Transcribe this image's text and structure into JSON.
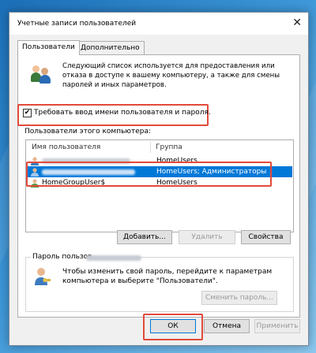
{
  "window": {
    "title": "Учетные записи пользователей",
    "close_glyph": "✕"
  },
  "tabs": [
    {
      "label": "Пользователи"
    },
    {
      "label": "Дополнительно"
    }
  ],
  "intro_text": "Следующий список используется для предоставления или отказа в доступе к вашему компьютеру, а также для смены паролей и иных параметров.",
  "require_login": {
    "label": "Требовать ввод имени пользователя и пароля.",
    "checked_glyph": "✔"
  },
  "users_section_label": "Пользователи этого компьютера:",
  "users_table": {
    "columns": [
      "Имя пользователя",
      "Группа"
    ],
    "rows": [
      {
        "name": "",
        "group": "HomeUsers",
        "selected": false
      },
      {
        "name": "",
        "group": "HomeUsers; Администраторы",
        "selected": true
      },
      {
        "name": "HomeGroupUser$",
        "group": "HomeUsers",
        "selected": false
      }
    ]
  },
  "buttons": {
    "add": "Добавить...",
    "remove": "Удалить",
    "properties": "Свойства"
  },
  "password_group": {
    "legend": "Пароль пользов",
    "text": "Чтобы изменить свой пароль, перейдите к параметрам компьютера и выберите \"Пользователи\".",
    "change_button": "Сменить пароль..."
  },
  "dialog_buttons": {
    "ok": "ОК",
    "cancel": "Отмена",
    "apply": "Применить"
  },
  "colors": {
    "highlight": "#0078d7",
    "annotation": "#e24a3b"
  },
  "icons": {
    "users": "users-icon",
    "user_row": "user-icon",
    "key_user": "user-key-icon"
  }
}
